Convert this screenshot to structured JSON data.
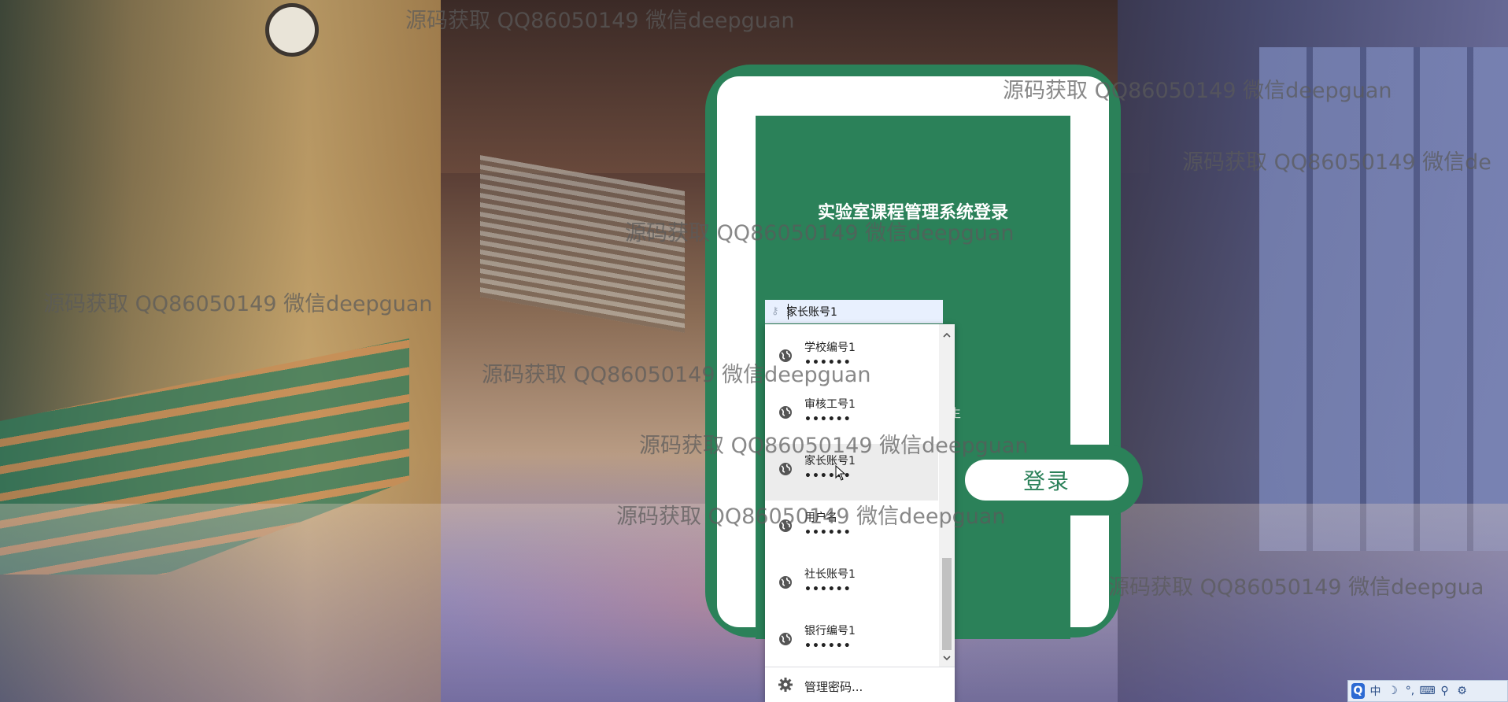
{
  "background": {
    "description_icon": "school-hallway-background"
  },
  "watermark_text": "源码获取 QQ86050149 微信deepguan",
  "watermark_clipped": "源码获取 QQ86050149 微信de",
  "watermark_clipped2": "源码获取 QQ86050149 微信deepgua",
  "login": {
    "title": "实验室课程管理系统登录",
    "hint_char": "生",
    "login_button": "登录",
    "username_value": "家长账号1"
  },
  "autocomplete": {
    "items": [
      {
        "username": "学校编号1",
        "password_mask": "••••••"
      },
      {
        "username": "审核工号1",
        "password_mask": "••••••"
      },
      {
        "username": "家长账号1",
        "password_mask": "••••••"
      },
      {
        "username": "用户名",
        "password_mask": "••••••"
      },
      {
        "username": "社长账号1",
        "password_mask": "••••••"
      },
      {
        "username": "银行编号1",
        "password_mask": "••••••"
      }
    ],
    "hovered_index": 2,
    "manage_label": "管理密码...",
    "item_icon": "globe-icon",
    "manage_icon": "gear-icon"
  },
  "tray": {
    "items": [
      "Q",
      "中",
      "☽",
      "°,",
      "⌨",
      "⚲",
      "⚙"
    ],
    "icons": [
      "ime-logo-icon",
      "chinese-mode-icon",
      "half-width-icon",
      "punctuation-icon",
      "keyboard-icon",
      "voice-icon",
      "tools-icon"
    ]
  },
  "colors": {
    "brand_green": "#2b8159",
    "autofill_blue": "#e8f0fe"
  }
}
